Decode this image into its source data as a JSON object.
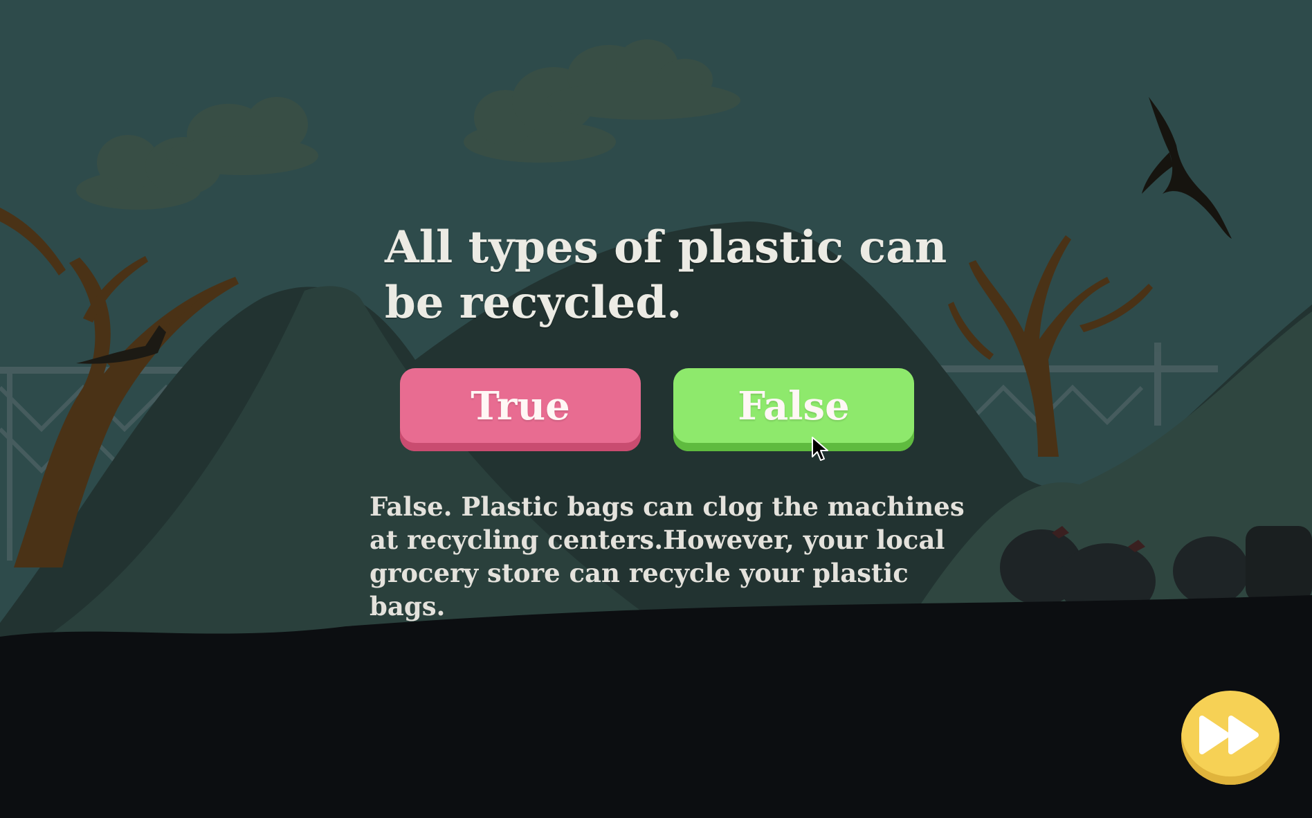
{
  "quiz": {
    "question": "All types of plastic can be recycled.",
    "options": [
      {
        "label": "True",
        "color": "#e86c91"
      },
      {
        "label": "False",
        "color": "#8ee96c"
      }
    ],
    "explanation": "False. Plastic bags can clog the machines at recycling centers.However, your local grocery store can recycle your plastic bags."
  },
  "controls": {
    "skip_icon": "fast-forward-icon",
    "skip_color": "#f6d155"
  },
  "scene": {
    "sky_color": "#2e4b4b",
    "ground_color": "#0c0e11"
  }
}
